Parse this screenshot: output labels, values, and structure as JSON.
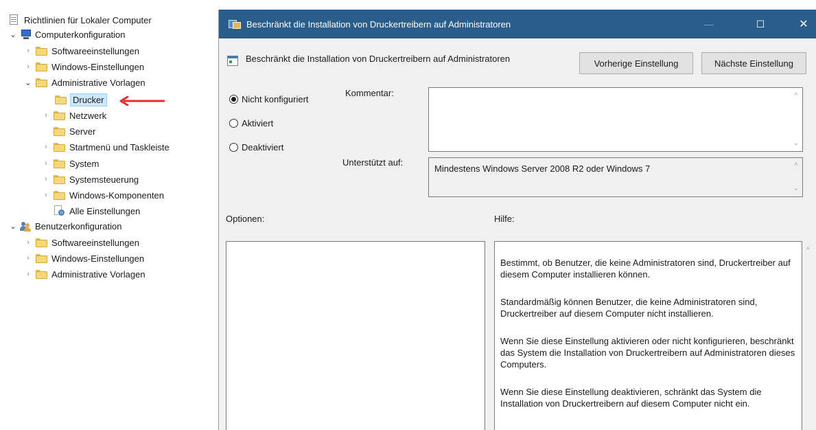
{
  "tree": {
    "root": "Richtlinien für Lokaler Computer",
    "computer_config": "Computerkonfiguration",
    "computer_children": [
      "Softwareeinstellungen",
      "Windows-Einstellungen",
      "Administrative Vorlagen"
    ],
    "admin_children": [
      "Drucker",
      "Netzwerk",
      "Server",
      "Startmenü und Taskleiste",
      "System",
      "Systemsteuerung",
      "Windows-Komponenten",
      "Alle Einstellungen"
    ],
    "user_config": "Benutzerkonfiguration",
    "user_children": [
      "Softwareeinstellungen",
      "Windows-Einstellungen",
      "Administrative Vorlagen"
    ]
  },
  "dialog": {
    "title": "Beschränkt die Installation von Druckertreibern auf Administratoren",
    "window_controls": {
      "minimize": "—",
      "maximize": "☐",
      "close": "✕"
    },
    "header_text": "Beschränkt die Installation von Druckertreibern auf Administratoren",
    "prev_button": "Vorherige Einstellung",
    "next_button": "Nächste Einstellung",
    "radios": {
      "not_configured": "Nicht konfiguriert",
      "enabled": "Aktiviert",
      "disabled": "Deaktiviert"
    },
    "selected_radio": "not_configured",
    "comment_label": "Kommentar:",
    "comment_value": "",
    "supported_label": "Unterstützt auf:",
    "supported_value": "Mindestens Windows Server 2008 R2 oder Windows 7",
    "options_label": "Optionen:",
    "help_label": "Hilfe:",
    "help_paragraphs": [
      "Bestimmt, ob Benutzer, die keine Administratoren sind, Druckertreiber auf diesem Computer installieren können.",
      "Standardmäßig können Benutzer, die keine Administratoren sind, Druckertreiber auf diesem Computer nicht installieren.",
      "Wenn Sie diese Einstellung aktivieren oder nicht konfigurieren, beschränkt das System die Installation von Druckertreibern auf Administratoren dieses Computers.",
      "Wenn Sie diese Einstellung deaktivieren, schränkt das System die Installation von Druckertreibern auf diesem Computer nicht ein."
    ]
  },
  "colors": {
    "titlebar": "#2a5d8a",
    "annotation_arrow": "#e03030",
    "selection": "#cce8ff"
  }
}
